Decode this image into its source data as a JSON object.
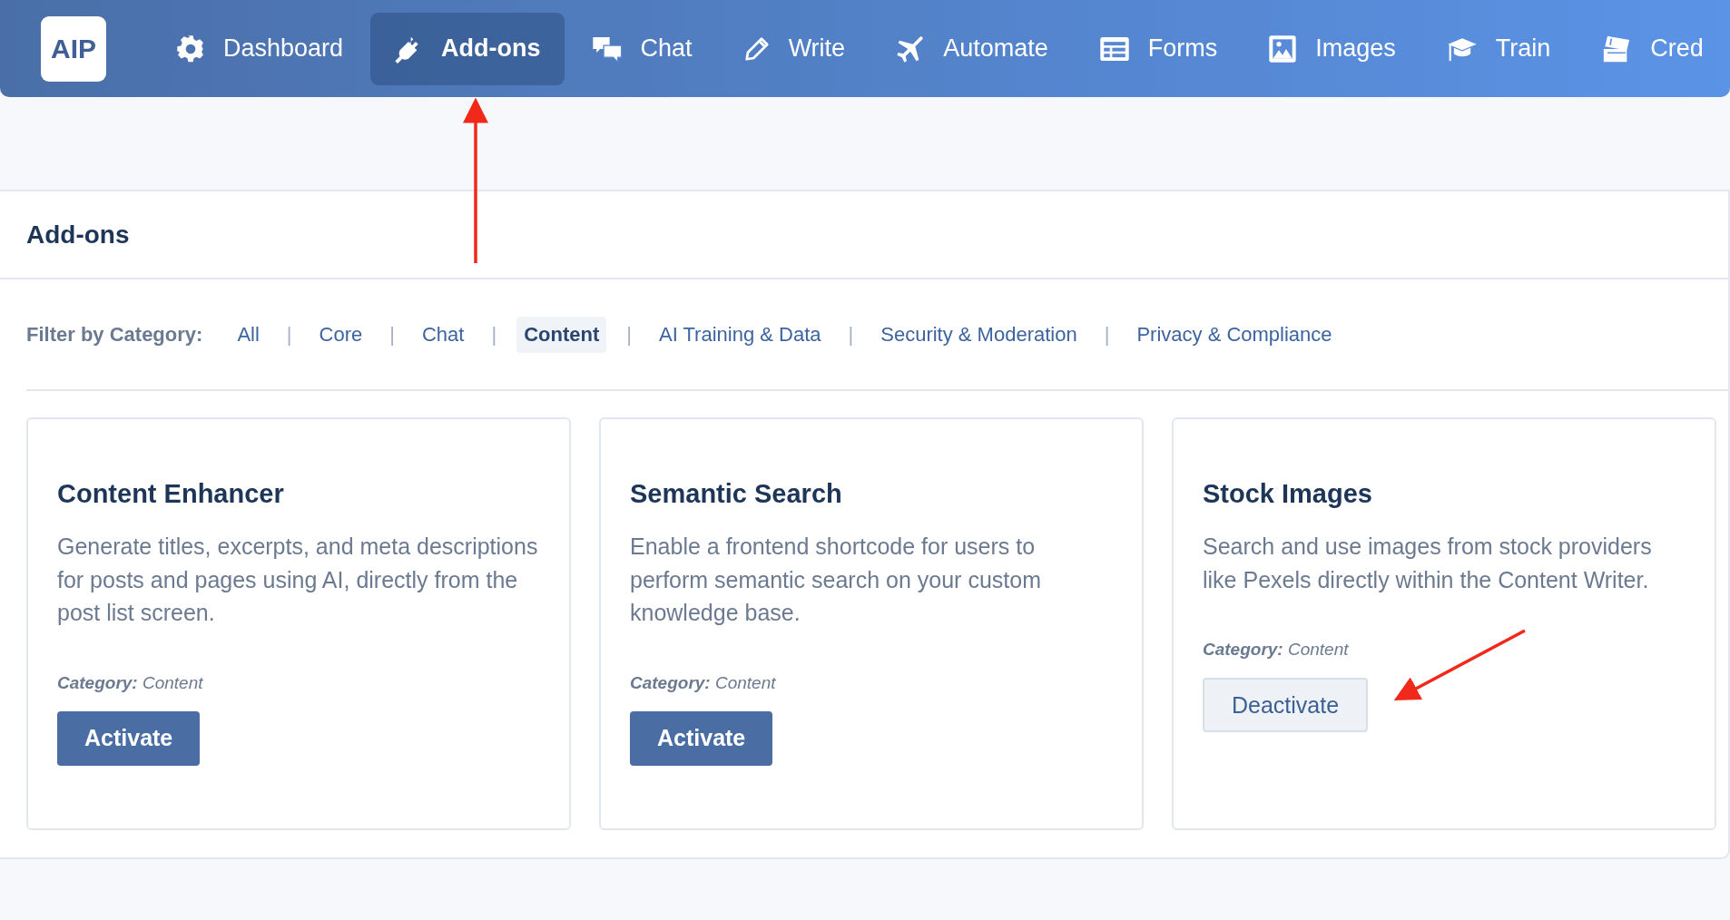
{
  "logo": {
    "text": "AIP"
  },
  "nav": [
    {
      "label": "Dashboard",
      "selected": false
    },
    {
      "label": "Add-ons",
      "selected": true
    },
    {
      "label": "Chat",
      "selected": false
    },
    {
      "label": "Write",
      "selected": false
    },
    {
      "label": "Automate",
      "selected": false
    },
    {
      "label": "Forms",
      "selected": false
    },
    {
      "label": "Images",
      "selected": false
    },
    {
      "label": "Train",
      "selected": false
    },
    {
      "label": "Cred",
      "selected": false
    }
  ],
  "page": {
    "title": "Add-ons"
  },
  "filter": {
    "label": "Filter by Category:",
    "categories": [
      {
        "label": "All",
        "selected": false,
        "separator": "|"
      },
      {
        "label": "Core",
        "selected": false,
        "separator": "|"
      },
      {
        "label": "Chat",
        "selected": false,
        "separator": "|"
      },
      {
        "label": "Content",
        "selected": true,
        "separator": "|"
      },
      {
        "label": "AI Training & Data",
        "selected": false,
        "separator": "|"
      },
      {
        "label": "Security & Moderation",
        "selected": false,
        "separator": "|"
      },
      {
        "label": "Privacy & Compliance",
        "selected": false
      }
    ]
  },
  "addons": [
    {
      "title": "Content Enhancer",
      "description": "Generate titles, excerpts, and meta descriptions for posts and pages using AI, directly from the post list screen.",
      "category_label": "Category:",
      "category": "Content",
      "button": {
        "label": "Activate",
        "kind": "activate"
      }
    },
    {
      "title": "Semantic Search",
      "description": "Enable a frontend shortcode for users to perform semantic search on your custom knowledge base.",
      "category_label": "Category:",
      "category": "Content",
      "button": {
        "label": "Activate",
        "kind": "activate"
      }
    },
    {
      "title": "Stock Images",
      "description": "Search and use images from stock providers like Pexels directly within the Content Writer.",
      "category_label": "Category:",
      "category": "Content",
      "button": {
        "label": "Deactivate",
        "kind": "deactivate"
      }
    }
  ]
}
